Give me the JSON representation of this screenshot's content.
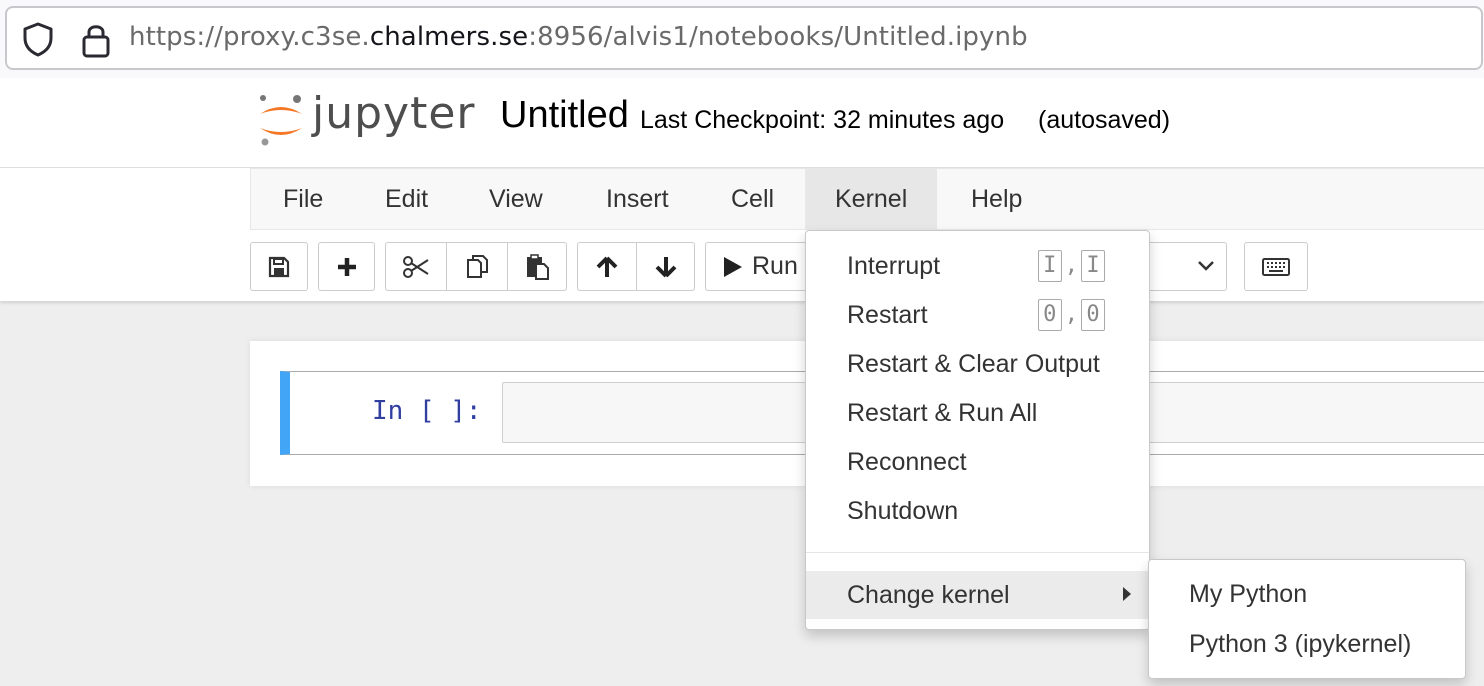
{
  "browser": {
    "url_prefix": "https://proxy.c3se.",
    "url_host": "chalmers.se",
    "url_suffix": ":8956/alvis1/notebooks/Untitled.ipynb"
  },
  "header": {
    "logo_text": "jupyter",
    "notebook_name": "Untitled",
    "checkpoint": "Last Checkpoint: 32 minutes ago",
    "autosave": "(autosaved)"
  },
  "menubar": {
    "items": [
      "File",
      "Edit",
      "View",
      "Insert",
      "Cell",
      "Kernel",
      "Help"
    ],
    "open_menu": "Kernel"
  },
  "toolbar": {
    "run_label": "Run"
  },
  "cell": {
    "prompt": "In [ ]:"
  },
  "kernel_menu": {
    "items": [
      {
        "label": "Interrupt",
        "shortcut": [
          "I",
          "I"
        ]
      },
      {
        "label": "Restart",
        "shortcut": [
          "0",
          "0"
        ]
      },
      {
        "label": "Restart & Clear Output"
      },
      {
        "label": "Restart & Run All"
      },
      {
        "label": "Reconnect"
      },
      {
        "label": "Shutdown"
      }
    ],
    "change_kernel": "Change kernel",
    "kernels": [
      "My Python",
      "Python 3 (ipykernel)"
    ]
  },
  "colors": {
    "cell_selected_bar": "#42a5f5",
    "prompt": "#303f9f",
    "logo_orange": "#f37726"
  }
}
